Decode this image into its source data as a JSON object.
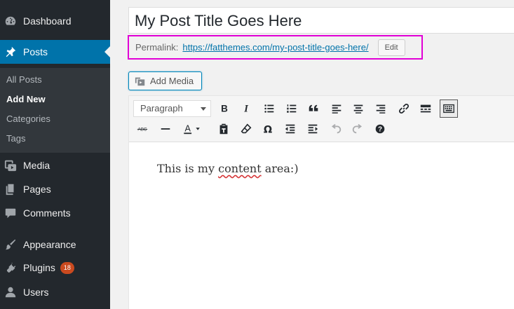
{
  "sidebar": {
    "menu": [
      {
        "label": "Dashboard",
        "icon": "dashboard-icon"
      },
      {
        "label": "Posts",
        "icon": "pushpin-icon",
        "active": true
      },
      {
        "label": "Media",
        "icon": "media-icon"
      },
      {
        "label": "Pages",
        "icon": "pages-icon"
      },
      {
        "label": "Comments",
        "icon": "comments-icon"
      },
      {
        "label": "Appearance",
        "icon": "paintbrush-icon"
      },
      {
        "label": "Plugins",
        "icon": "plugin-icon",
        "badge": "18"
      },
      {
        "label": "Users",
        "icon": "users-icon"
      }
    ],
    "submenu": [
      {
        "label": "All Posts"
      },
      {
        "label": "Add New",
        "current": true
      },
      {
        "label": "Categories"
      },
      {
        "label": "Tags"
      }
    ],
    "colors": {
      "background": "#23282d",
      "active": "#0073aa",
      "submenu_bg": "#32373c",
      "badge": "#ca4a1f"
    }
  },
  "post": {
    "title": "My Post Title Goes Here",
    "permalink_label": "Permalink:",
    "permalink_url": "https://fatthemes.com/my-post-title-goes-here/",
    "edit_label": "Edit"
  },
  "add_media_label": "Add Media",
  "toolbar": {
    "format_value": "Paragraph",
    "row1": [
      "bold-icon",
      "italic-icon",
      "bullet-list-icon",
      "numbered-list-icon",
      "blockquote-icon",
      "align-left-icon",
      "align-center-icon",
      "align-right-icon",
      "link-icon",
      "read-more-icon",
      "toolbar-toggle-icon"
    ],
    "row2": [
      "strikethrough-icon",
      "horizontal-line-icon",
      "text-color-icon",
      "paste-text-icon",
      "clear-formatting-icon",
      "special-character-icon",
      "outdent-icon",
      "indent-icon",
      "undo-icon",
      "redo-icon",
      "help-icon"
    ]
  },
  "content": {
    "text_before": "This is my ",
    "text_spell": "content",
    "text_after": " area:)"
  },
  "highlight_color": "#e100d6"
}
